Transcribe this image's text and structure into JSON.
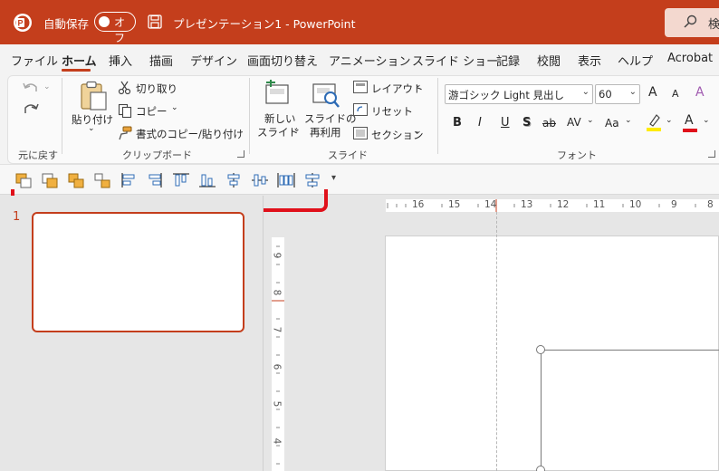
{
  "titlebar": {
    "autosave_label": "自動保存",
    "toggle_state": "オフ",
    "doc_title": "プレゼンテーション1  -  PowerPoint",
    "search_text": "検"
  },
  "tabs": [
    "ファイル",
    "ホーム",
    "挿入",
    "描画",
    "デザイン",
    "画面切り替え",
    "アニメーション",
    "スライド ショー",
    "記録",
    "校閲",
    "表示",
    "ヘルプ",
    "Acrobat"
  ],
  "active_tab": "ホーム",
  "ribbon": {
    "undo_group": "元に戻す",
    "clipboard": {
      "paste": "貼り付け",
      "cut": "切り取り",
      "copy": "コピー",
      "format_painter": "書式のコピー/貼り付け",
      "group": "クリップボード"
    },
    "slides": {
      "new_slide_1": "新しい",
      "new_slide_2": "スライド",
      "reuse_1": "スライドの",
      "reuse_2": "再利用",
      "layout": "レイアウト",
      "reset": "リセット",
      "section": "セクション",
      "group": "スライド"
    },
    "font": {
      "font_name": "游ゴシック Light 見出し",
      "font_size": "60",
      "group": "フォント",
      "bold": "B",
      "italic": "I",
      "underline": "U",
      "shadow": "S",
      "strike": "ab",
      "spacing": "AV",
      "case": "Aa",
      "grow": "A",
      "shrink": "A",
      "color": "A"
    }
  },
  "slide_panel": {
    "slide_number": "1"
  },
  "ruler": {
    "h_ticks": [
      "16",
      "15",
      "14",
      "13",
      "12",
      "11",
      "10",
      "9",
      "8"
    ],
    "v_ticks": [
      "9",
      "8",
      "7",
      "6",
      "5",
      "4"
    ]
  },
  "colors": {
    "accent": "#c43e1c",
    "annotation": "#e0101a"
  }
}
